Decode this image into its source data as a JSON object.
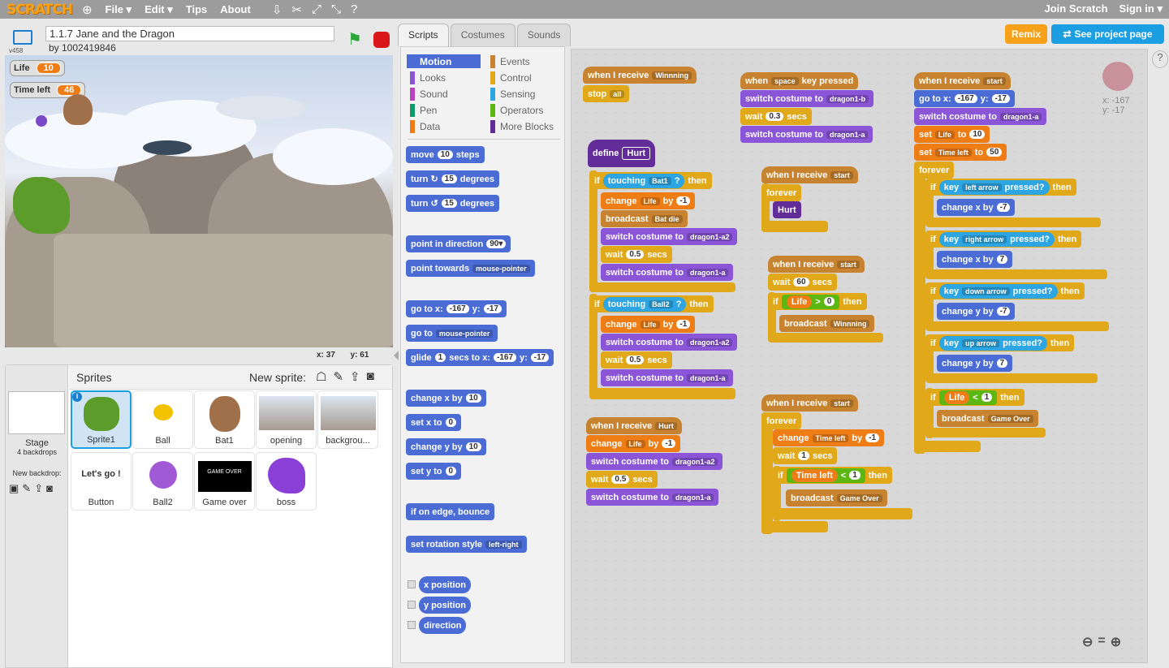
{
  "menubar": {
    "logo": "SCRATCH",
    "file": "File ▾",
    "edit": "Edit ▾",
    "tips": "Tips",
    "about": "About",
    "join": "Join Scratch",
    "signin": "Sign in ▾"
  },
  "project": {
    "title": "1.1.7 Jane and the Dragon",
    "by": "by 1002419846",
    "version": "v458"
  },
  "monitors": {
    "life_label": "Life",
    "life_value": "10",
    "time_label": "Time left",
    "time_value": "46"
  },
  "coords": {
    "x_label": "x:",
    "x": "37",
    "y_label": "y:",
    "y": "61"
  },
  "sprites_panel": {
    "header": "Sprites",
    "new_sprite": "New sprite:",
    "stage_label": "Stage",
    "stage_sub": "4 backdrops",
    "new_backdrop": "New backdrop:",
    "items": [
      "Sprite1",
      "Ball",
      "Bat1",
      "opening",
      "backgrou...",
      "Button",
      "Ball2",
      "Game over",
      "boss"
    ],
    "button_text": "Let's go !",
    "gameover_text": "GAME OVER"
  },
  "tabs": [
    "Scripts",
    "Costumes",
    "Sounds"
  ],
  "actions": {
    "remix": "Remix",
    "see_project": "See project page"
  },
  "categories": [
    "Motion",
    "Looks",
    "Sound",
    "Pen",
    "Data",
    "Events",
    "Control",
    "Sensing",
    "Operators",
    "More Blocks"
  ],
  "palette": {
    "move": "move",
    "move_n": "10",
    "steps": "steps",
    "turn_r": "turn ↻",
    "turn_l": "turn ↺",
    "deg_n": "15",
    "degrees": "degrees",
    "point_dir": "point in direction",
    "dir_v": "90▾",
    "point_towards": "point towards",
    "towards_v": "mouse-pointer",
    "goto_xy": "go to x:",
    "x_v": "-167",
    "y_lbl": "y:",
    "y_v": "-17",
    "goto": "go to",
    "goto_v": "mouse-pointer",
    "glide": "glide",
    "glide_n": "1",
    "glide_secs": "secs to x:",
    "change_x": "change x by",
    "set_x": "set x to",
    "change_y": "change y by",
    "set_y": "set y to",
    "zero": "0",
    "edge": "if on edge, bounce",
    "rot": "set rotation style",
    "rot_v": "left-right",
    "xpos": "x position",
    "ypos": "y position",
    "direction": "direction"
  },
  "scripts": {
    "recv": "when I receive",
    "winning": "Winnning",
    "stop": "stop",
    "all": "all",
    "when": "when",
    "space": "space",
    "key_pressed": "key pressed",
    "switch": "switch costume to",
    "d1b": "dragon1-b",
    "d1a": "dragon1-a",
    "d1a2": "dragon1-a2",
    "wait": "wait",
    "secs": "secs",
    "w03": "0.3",
    "w05": "0.5",
    "w1": "1",
    "w60": "60",
    "define": "define",
    "hurt": "Hurt",
    "if": "if",
    "then": "then",
    "touching": "touching",
    "bat1": "Bat1",
    "ball2": "Ball2",
    "q": "?",
    "change": "change",
    "by": "by",
    "life": "Life",
    "neg1": "-1",
    "time_left": "Time left",
    "broadcast": "broadcast",
    "batdie": "Bat die",
    "gameover": "Game Over",
    "start": "start",
    "forever": "forever",
    "gt": ">",
    "lt": "<",
    "zero": "0",
    "one": "1",
    "goto": "go to x:",
    "xv": "-167",
    "yl": "y:",
    "yv": "-17",
    "set": "set",
    "to": "to",
    "ten": "10",
    "fifty": "50",
    "key": "key",
    "left_arrow": "left arrow",
    "right_arrow": "right arrow",
    "down_arrow": "down arrow",
    "up_arrow": "up arrow",
    "pressed": "pressed?",
    "chx": "change x by",
    "chy": "change y by",
    "m7": "-7",
    "p7": "7"
  },
  "sprite_info": {
    "x": "x: -167",
    "y": "y: -17"
  },
  "colors": {
    "motion": "#4a6cd4",
    "control": "#e1a91a",
    "events": "#c88330",
    "looks": "#8a55d7",
    "operators": "#5cb712",
    "sensing": "#2ca5e2",
    "data": "#ee7d16",
    "more": "#632d99"
  }
}
